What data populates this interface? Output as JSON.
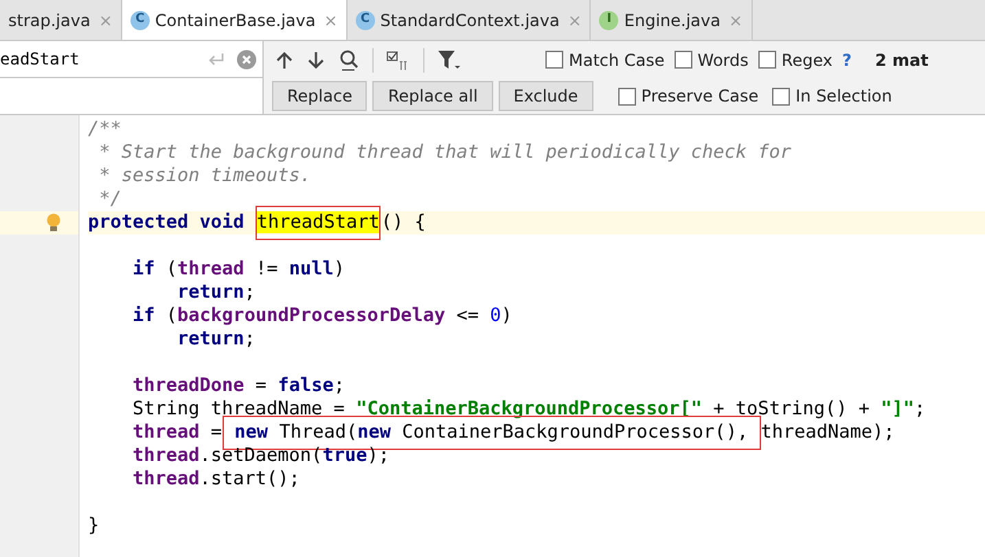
{
  "tabs": [
    {
      "label": "strap.java",
      "selected": false,
      "close": "×"
    },
    {
      "label": "ContainerBase.java",
      "kind": "class",
      "icon_letter": "C",
      "selected": true,
      "close": "×"
    },
    {
      "label": "StandardContext.java",
      "kind": "class",
      "icon_letter": "C",
      "selected": false,
      "close": "×"
    },
    {
      "label": "Engine.java",
      "kind": "interface",
      "icon_letter": "I",
      "selected": false,
      "close": "×"
    }
  ],
  "find_bar": {
    "search": {
      "value": "eadStart"
    },
    "options": [
      {
        "label": "Match Case",
        "checked": false
      },
      {
        "label": "Words",
        "checked": false
      },
      {
        "label": "Regex",
        "checked": false
      }
    ],
    "help": "?",
    "match_count": "2 mat",
    "buttons": [
      "Replace",
      "Replace all",
      "Exclude"
    ],
    "replace_options": [
      {
        "label": "Preserve Case",
        "checked": false
      },
      {
        "label": "In Selection",
        "checked": false
      }
    ]
  },
  "editor": {
    "lines": [
      {
        "current": false,
        "tokens": [
          {
            "kind": "comment",
            "text": "/**"
          }
        ]
      },
      {
        "current": false,
        "tokens": [
          {
            "kind": "comment",
            "text": " * Start the background thread that will periodically check for"
          }
        ]
      },
      {
        "current": false,
        "tokens": [
          {
            "kind": "comment",
            "text": " * session timeouts."
          }
        ]
      },
      {
        "current": false,
        "tokens": [
          {
            "kind": "comment",
            "text": " */"
          }
        ]
      },
      {
        "current": true,
        "tokens": [
          {
            "kind": "keyword",
            "text": "protected void "
          },
          {
            "kind": "plain",
            "text": "threadStart",
            "highlight": true,
            "boxed": true
          },
          {
            "kind": "plain",
            "text": "() {"
          }
        ]
      },
      {
        "current": false
      },
      {
        "current": false,
        "tokens": [
          {
            "kind": "keyword",
            "text": "    if"
          },
          {
            "kind": "plain",
            "text": " ("
          },
          {
            "kind": "field",
            "text": "thread"
          },
          {
            "kind": "plain",
            "text": " != "
          },
          {
            "kind": "keyword",
            "text": "null"
          },
          {
            "kind": "plain",
            "text": ")"
          }
        ]
      },
      {
        "current": false,
        "tokens": [
          {
            "kind": "keyword",
            "text": "        return"
          },
          {
            "kind": "plain",
            "text": ";"
          }
        ]
      },
      {
        "current": false,
        "tokens": [
          {
            "kind": "keyword",
            "text": "    if"
          },
          {
            "kind": "plain",
            "text": " ("
          },
          {
            "kind": "field",
            "text": "backgroundProcessorDelay"
          },
          {
            "kind": "plain",
            "text": " <= "
          },
          {
            "kind": "number",
            "text": "0"
          },
          {
            "kind": "plain",
            "text": ")"
          }
        ]
      },
      {
        "current": false,
        "tokens": [
          {
            "kind": "keyword",
            "text": "        return"
          },
          {
            "kind": "plain",
            "text": ";"
          }
        ]
      },
      {
        "current": false
      },
      {
        "current": false,
        "tokens": [
          {
            "kind": "field",
            "text": "    threadDone"
          },
          {
            "kind": "plain",
            "text": " = "
          },
          {
            "kind": "keyword",
            "text": "false"
          },
          {
            "kind": "plain",
            "text": ";"
          }
        ]
      },
      {
        "current": false,
        "tokens": [
          {
            "kind": "plain",
            "text": "    String threadName = "
          },
          {
            "kind": "string",
            "text": "\"ContainerBackgroundProcessor[\""
          },
          {
            "kind": "plain",
            "text": " + toString() + "
          },
          {
            "kind": "string",
            "text": "\"]\""
          },
          {
            "kind": "plain",
            "text": ";"
          }
        ]
      },
      {
        "current": false,
        "tokens": [
          {
            "kind": "field",
            "text": "    thread"
          },
          {
            "kind": "plain",
            "text": " ="
          },
          {
            "kind": "keyword",
            "text": " new",
            "boxed": true
          },
          {
            "kind": "plain",
            "text": " Thread(",
            "boxed": true
          },
          {
            "kind": "keyword",
            "text": "new",
            "boxed": true
          },
          {
            "kind": "plain",
            "text": " ContainerBackgroundProcessor(), ",
            "boxed": true
          },
          {
            "kind": "plain",
            "text": "threadName);"
          }
        ]
      },
      {
        "current": false,
        "tokens": [
          {
            "kind": "field",
            "text": "    thread"
          },
          {
            "kind": "plain",
            "text": ".setDaemon("
          },
          {
            "kind": "keyword",
            "text": "true"
          },
          {
            "kind": "plain",
            "text": ");"
          }
        ]
      },
      {
        "current": false,
        "tokens": [
          {
            "kind": "field",
            "text": "    thread"
          },
          {
            "kind": "plain",
            "text": ".start();"
          }
        ]
      },
      {
        "current": false
      },
      {
        "current": false,
        "tokens": [
          {
            "kind": "plain",
            "text": "}"
          }
        ]
      }
    ]
  }
}
